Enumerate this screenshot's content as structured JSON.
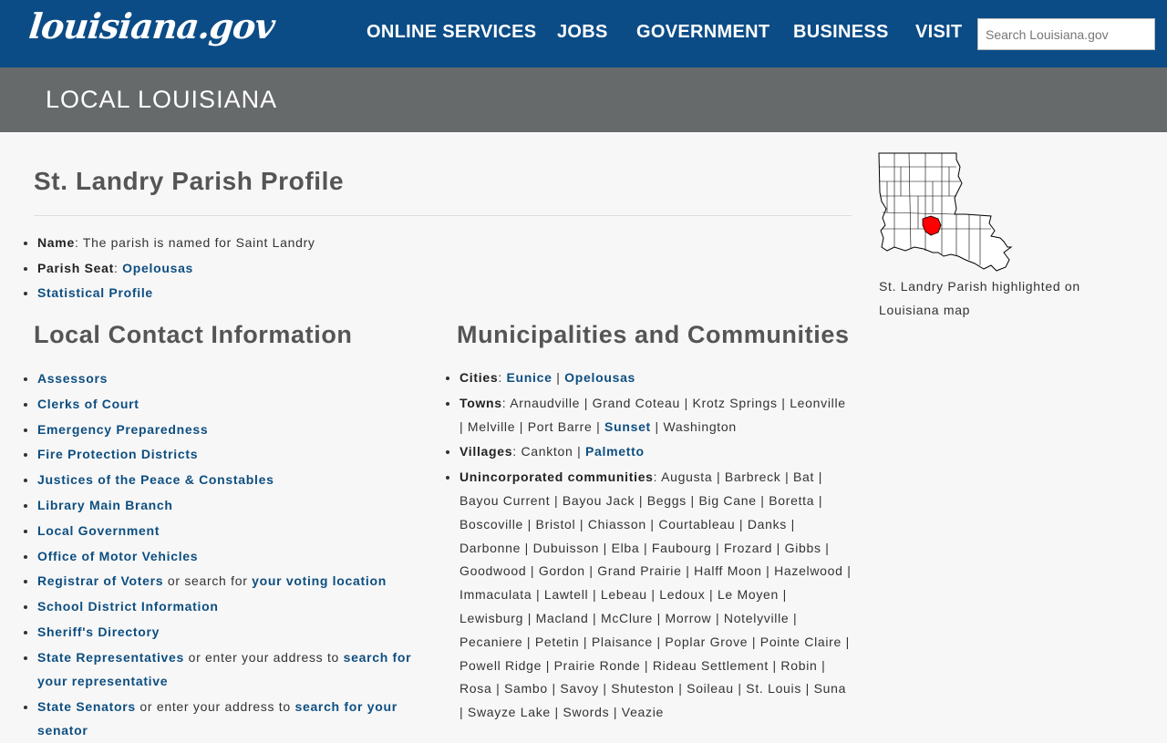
{
  "header": {
    "logo_text": "louisiana.gov",
    "nav": [
      "ONLINE SERVICES",
      "JOBS",
      "GOVERNMENT",
      "BUSINESS",
      "VISIT"
    ],
    "search_placeholder": "Search Louisiana.gov"
  },
  "band": {
    "title": "LOCAL LOUISIANA"
  },
  "profile": {
    "title": "St. Landry Parish Profile",
    "name_label": "Name",
    "name_value": ": The parish is named for Saint Landry",
    "seat_label": "Parish Seat",
    "seat_value": "Opelousas",
    "stat_profile": "Statistical Profile"
  },
  "contact": {
    "title": "Local Contact Information",
    "items": [
      "Assessors",
      "Clerks of Court",
      "Emergency Preparedness",
      "Fire Protection Districts",
      "Justices of the Peace & Constables",
      "Library Main Branch",
      "Local Government",
      "Office of Motor Vehicles"
    ],
    "registrar": {
      "link": "Registrar of Voters",
      "text": " or search for ",
      "link2": "your voting location"
    },
    "school": "School District Information",
    "sheriff": "Sheriff's Directory",
    "state_reps": {
      "link": "State Representatives",
      "text": " or enter your address to ",
      "link2": "search for your representative"
    },
    "state_sens": {
      "link": "State Senators",
      "text": " or enter your address to ",
      "link2": "search for your senator"
    }
  },
  "municipalities": {
    "title": "Municipalities and Communities",
    "cities_label": "Cities",
    "cities": [
      "Eunice",
      "Opelousas"
    ],
    "towns_label": "Towns",
    "towns_text1": ": Arnaudville | Grand Coteau | Krotz Springs | Leonville | Melville | Port Barre | ",
    "towns_link": "Sunset",
    "towns_text2": " | Washington",
    "villages_label": "Villages",
    "villages_text": ": Cankton | ",
    "villages_link": "Palmetto",
    "unincorporated_label": "Unincorporated communities",
    "unincorporated_text": ": Augusta | Barbreck | Bat | Bayou Current | Bayou Jack | Beggs | Big Cane | Boretta | Boscoville | Bristol | Chiasson | Courtableau | Danks | Darbonne | Dubuisson | Elba | Faubourg | Frozard | Gibbs | Goodwood | Gordon | Grand Prairie | Halff Moon | Hazelwood | Immaculata | Lawtell | Lebeau | Ledoux | Le Moyen | Lewisburg | Macland | McClure | Morrow | Notelyville | Pecaniere | Petetin | Plaisance | Poplar Grove | Pointe Claire | Powell Ridge | Prairie Ronde | Rideau Settlement | Robin | Rosa | Sambo | Savoy | Shuteston | Soileau | St. Louis | Suna | Swayze Lake | Swords | Veazie"
  },
  "map": {
    "caption": "St. Landry Parish highlighted on Louisiana map",
    "highlight_color": "#ff0000"
  },
  "colors": {
    "header_bg": "#0b4c86",
    "band_bg": "#666a6b",
    "link": "#0d4e80"
  }
}
